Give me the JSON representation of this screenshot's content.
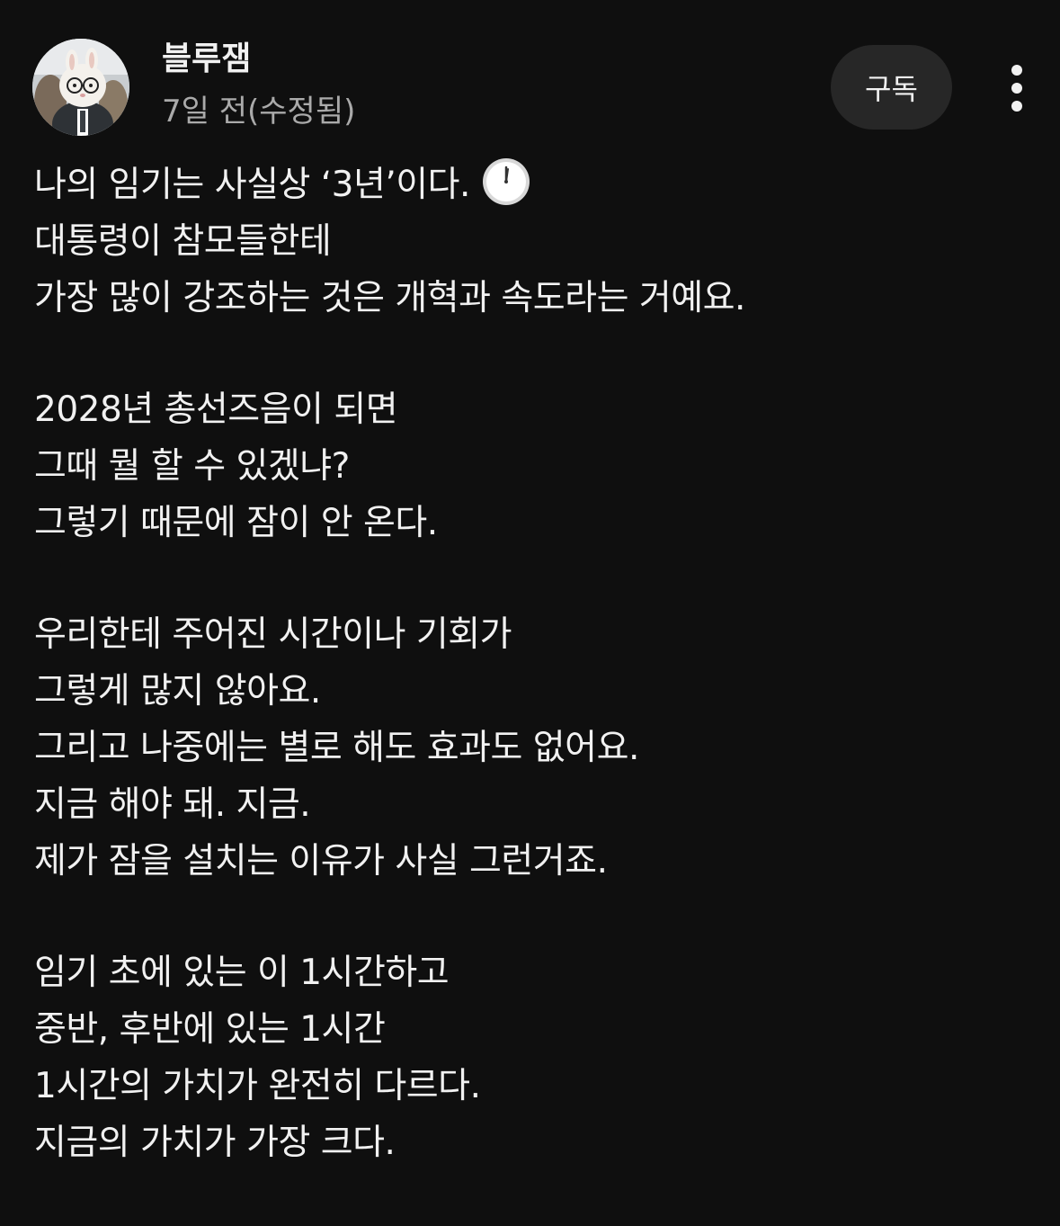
{
  "post": {
    "author": "블루잼",
    "time": "7일 전(수정됨)",
    "subscribe_label": "구독",
    "paragraphs": [
      [
        "나의 임기는 사실상 ‘3년’이다.",
        "대통령이 참모들한테",
        "가장 많이 강조하는 것은 개혁과 속도라는 거예요."
      ],
      [
        "2028년 총선즈음이 되면",
        "그때 뭘 할 수 있겠냐?",
        "그렇기 때문에 잠이 안 온다."
      ],
      [
        "우리한테 주어진 시간이나 기회가",
        "그렇게 많지 않아요.",
        "그리고 나중에는 별로 해도 효과도 없어요.",
        "지금 해야 돼. 지금.",
        "제가 잠을 설치는 이유가 사실 그런거죠."
      ],
      [
        "임기 초에 있는 이 1시간하고",
        "중반, 후반에 있는 1시간",
        "1시간의 가치가 완전히 다르다.",
        "지금의 가치가 가장 크다."
      ]
    ],
    "emoji_icon": "clock-icon"
  },
  "colors": {
    "background": "#0f0f0f",
    "text": "#f1f1f1",
    "secondary_text": "#aaaaaa",
    "button_bg": "#272727"
  }
}
